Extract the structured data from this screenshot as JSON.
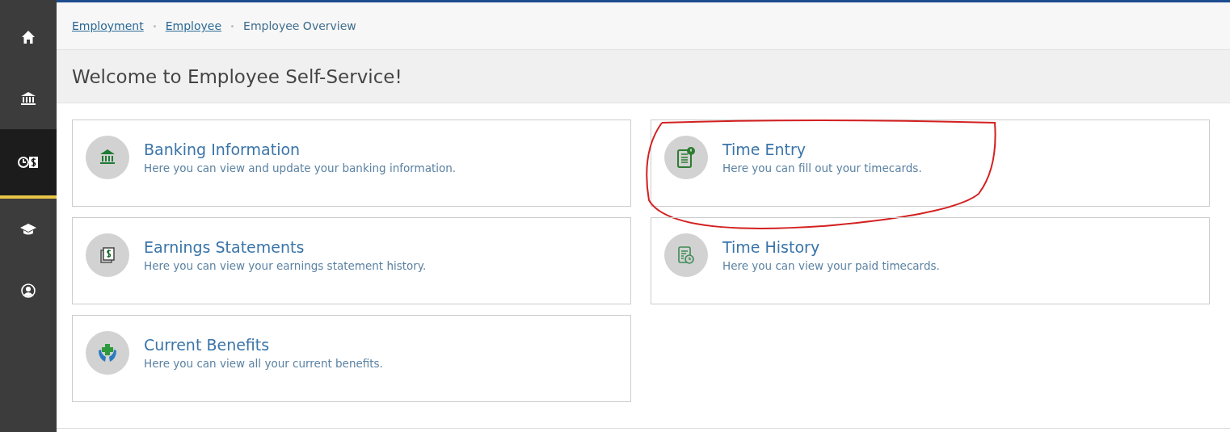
{
  "sidebar": {
    "items": [
      {
        "selected": false
      },
      {
        "selected": false
      },
      {
        "selected": true
      },
      {
        "selected": false
      },
      {
        "selected": false
      }
    ]
  },
  "breadcrumb": [
    {
      "label": "Employment",
      "link": true
    },
    {
      "label": "Employee",
      "link": true
    },
    {
      "label": "Employee Overview",
      "link": false
    }
  ],
  "title": "Welcome to Employee Self-Service!",
  "cards": [
    {
      "title": "Banking Information",
      "description": "Here you can view and update your banking information.",
      "highlighted": false
    },
    {
      "title": "Time Entry",
      "description": "Here you can fill out your timecards.",
      "highlighted": true
    },
    {
      "title": "Earnings Statements",
      "description": "Here you can view your earnings statement history.",
      "highlighted": false
    },
    {
      "title": "Time History",
      "description": "Here you can view your paid timecards.",
      "highlighted": false
    },
    {
      "title": "Current Benefits",
      "description": "Here you can view all your current benefits.",
      "highlighted": false
    }
  ]
}
